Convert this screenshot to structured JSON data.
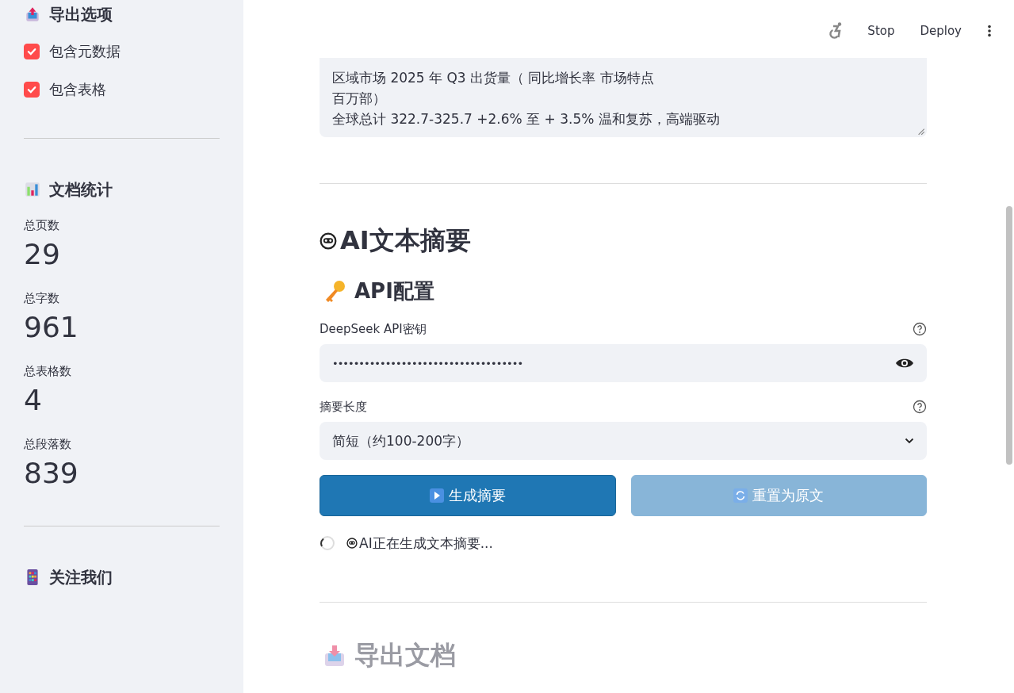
{
  "sidebar": {
    "export_options": {
      "title": "导出选项",
      "options": [
        {
          "label": "包含元数据",
          "checked": true
        },
        {
          "label": "包含表格",
          "checked": true
        }
      ]
    },
    "stats": {
      "title": "文档统计",
      "items": [
        {
          "label": "总页数",
          "value": "29"
        },
        {
          "label": "总字数",
          "value": "961"
        },
        {
          "label": "总表格数",
          "value": "4"
        },
        {
          "label": "总段落数",
          "value": "839"
        }
      ]
    },
    "follow": {
      "title": "关注我们"
    }
  },
  "header": {
    "stop": "Stop",
    "deploy": "Deploy"
  },
  "text_area": {
    "lines": [
      "区域市场 2025 年 Q3 出货量（ 同比增长率 市场特点",
      "百万部）",
      "全球总计 322.7-325.7 +2.6% 至 + 3.5% 温和复苏，高端驱动"
    ]
  },
  "summary": {
    "title": "AI文本摘要",
    "api_title": "API配置",
    "api_key": {
      "label": "DeepSeek API密钥",
      "value": "••••••••••••••••••••••••••••••••••••"
    },
    "length": {
      "label": "摘要长度",
      "value": "简短（约100-200字）"
    },
    "buttons": [
      {
        "label": "生成摘要",
        "kind": "primary",
        "disabled": false
      },
      {
        "label": "重置为原文",
        "kind": "reset",
        "disabled": true
      }
    ],
    "status": "AI正在生成文本摘要..."
  },
  "export": {
    "title": "导出文档"
  }
}
